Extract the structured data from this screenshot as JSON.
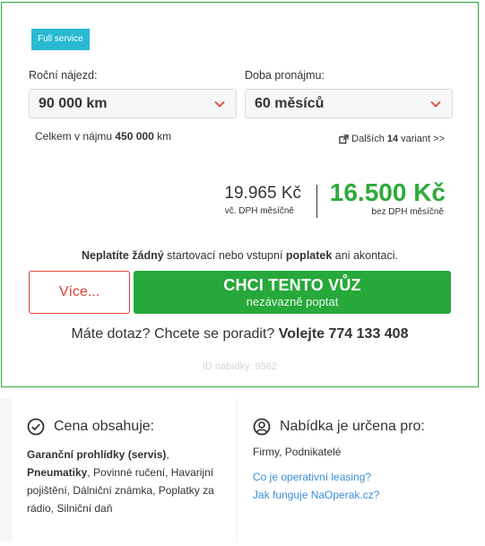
{
  "badge": "Full service",
  "mileage": {
    "label": "Roční nájezd:",
    "value": "90 000 km",
    "total_prefix": "Celkem v nájmu",
    "total_value": "450 000",
    "total_unit": "km"
  },
  "duration": {
    "label": "Doba pronájmu:",
    "value": "60 měsíců"
  },
  "variants": {
    "prefix": "Dalších",
    "count": "14",
    "suffix": "variant >>"
  },
  "price": {
    "with_vat": "19.965 Kč",
    "with_vat_note": "vč. DPH měsíčně",
    "main": "16.500 Kč",
    "main_note": "bez DPH měsíčně"
  },
  "fee_notice": {
    "bold1": "Neplatíte žádný",
    "mid": "startovací nebo vstupní",
    "bold2": "poplatek",
    "end": "ani akontaci."
  },
  "buttons": {
    "more": "Více...",
    "want_title": "CHCI TENTO VŮZ",
    "want_subtitle": "nezávazně poptat"
  },
  "question": {
    "text": "Máte dotaz? Chcete se poradit?",
    "bold": "Volejte 774 133 408"
  },
  "offer_id": "ID nabídky: 9562",
  "includes": {
    "title": "Cena obsahuje:",
    "item1_bold": "Garanční prohlídky (servis)",
    "item1_after": ",",
    "item2_bold": "Pneumatiky",
    "item2_after": ", Povinné ručení, Havarijní pojištění, Dálniční známka, Poplatky za rádio, Silniční daň"
  },
  "audience": {
    "title": "Nabídka je určena pro:",
    "value": "Firmy, Podnikatelé",
    "link1": "Co je operativní leasing?",
    "link2": "Jak funguje NaOperak.cz?"
  },
  "colors": {
    "accent_green": "#2eaa3a",
    "badge_blue": "#29b9d3",
    "danger_red": "#e04333",
    "link_blue": "#3a8fd8"
  },
  "icons": [
    "chevron-down-icon",
    "external-link-icon",
    "check-circle-icon",
    "user-circle-icon"
  ]
}
